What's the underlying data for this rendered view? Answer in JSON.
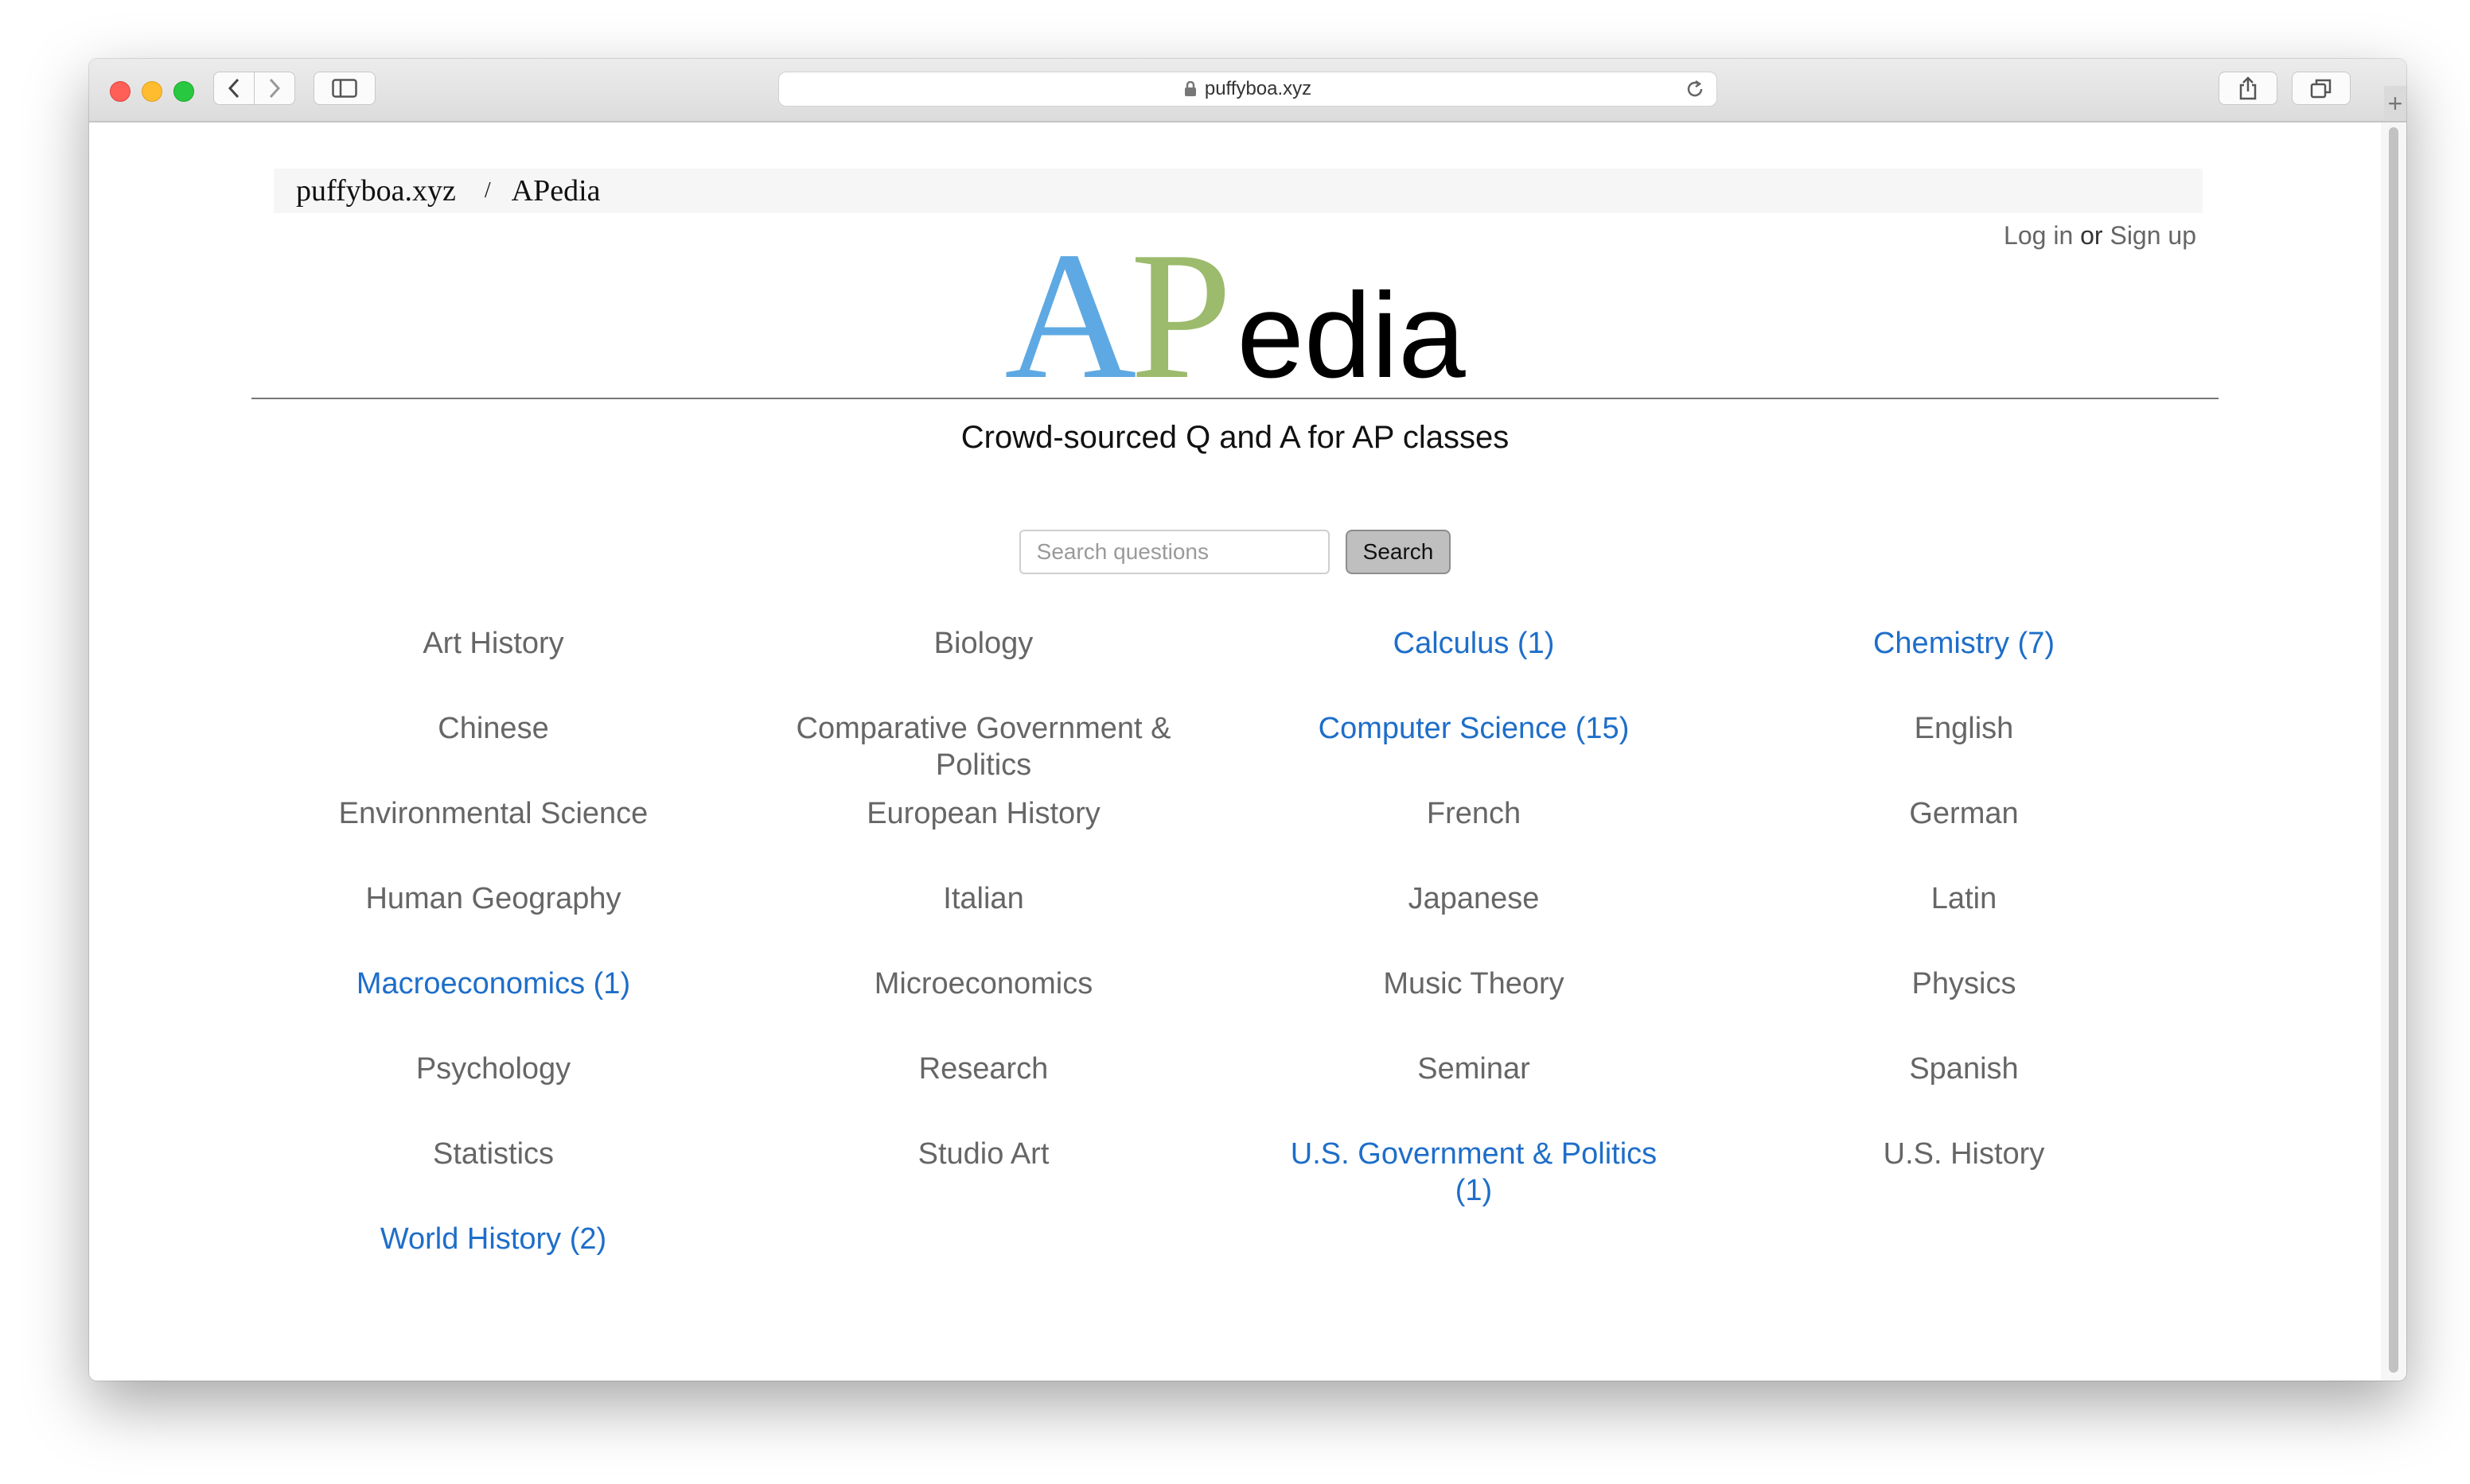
{
  "browser": {
    "url": "puffyboa.xyz"
  },
  "breadcrumb": {
    "site": "puffyboa.xyz",
    "separator": "/",
    "current": "APedia"
  },
  "auth": {
    "login": "Log in",
    "or": "or",
    "signup": "Sign up"
  },
  "logo": {
    "a": "A",
    "p": "P",
    "rest": "edia",
    "colors": {
      "a": "#5ea9e3",
      "p": "#9cbb6c",
      "rest": "#000000"
    }
  },
  "tagline": "Crowd-sourced Q and A for AP classes",
  "search": {
    "placeholder": "Search questions",
    "value": "",
    "button": "Search"
  },
  "colors": {
    "link_active": "#1e6ec9",
    "link_inactive": "#666666"
  },
  "subjects": [
    {
      "label": "Art History",
      "active": false
    },
    {
      "label": "Biology",
      "active": false
    },
    {
      "label": "Calculus (1)",
      "active": true
    },
    {
      "label": "Chemistry (7)",
      "active": true
    },
    {
      "label": "Chinese",
      "active": false
    },
    {
      "label": "Comparative Government & Politics",
      "active": false
    },
    {
      "label": "Computer Science (15)",
      "active": true
    },
    {
      "label": "English",
      "active": false
    },
    {
      "label": "Environmental Science",
      "active": false
    },
    {
      "label": "European History",
      "active": false
    },
    {
      "label": "French",
      "active": false
    },
    {
      "label": "German",
      "active": false
    },
    {
      "label": "Human Geography",
      "active": false
    },
    {
      "label": "Italian",
      "active": false
    },
    {
      "label": "Japanese",
      "active": false
    },
    {
      "label": "Latin",
      "active": false
    },
    {
      "label": "Macroeconomics (1)",
      "active": true
    },
    {
      "label": "Microeconomics",
      "active": false
    },
    {
      "label": "Music Theory",
      "active": false
    },
    {
      "label": "Physics",
      "active": false
    },
    {
      "label": "Psychology",
      "active": false
    },
    {
      "label": "Research",
      "active": false
    },
    {
      "label": "Seminar",
      "active": false
    },
    {
      "label": "Spanish",
      "active": false
    },
    {
      "label": "Statistics",
      "active": false
    },
    {
      "label": "Studio Art",
      "active": false
    },
    {
      "label": "U.S. Government & Politics (1)",
      "active": true
    },
    {
      "label": "U.S. History",
      "active": false
    },
    {
      "label": "World History (2)",
      "active": true
    }
  ]
}
